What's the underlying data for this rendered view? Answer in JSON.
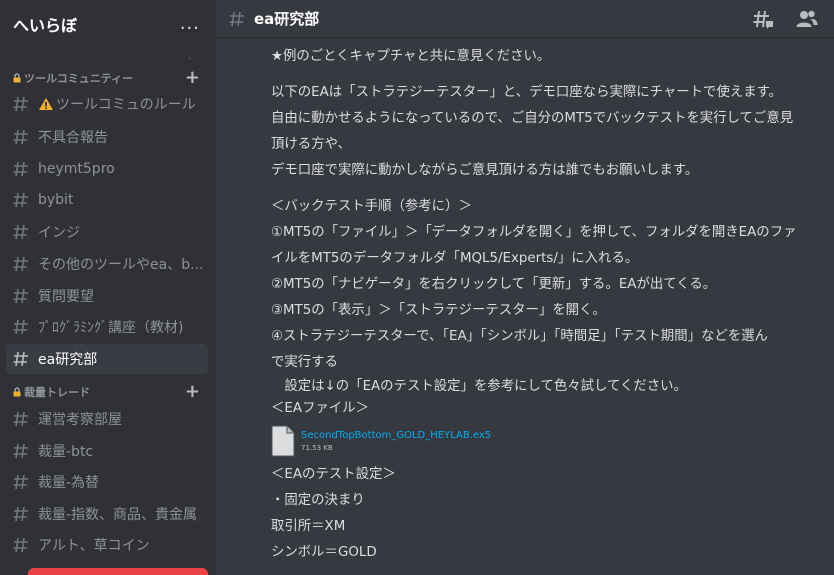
{
  "server": {
    "name": "へいらぼ",
    "menu_label": "..."
  },
  "sidebar": {
    "categories": [
      {
        "label": "ツールコミュニティー",
        "channels": [
          "ツールコミュのルール",
          "不具合報告",
          "heymt5pro",
          "bybit",
          "インジ",
          "その他のツールやea、b...",
          "質問要望",
          "ﾌﾟﾛｸﾞﾗﾐﾝｸﾞ講座（教材)",
          "ea研究部"
        ]
      },
      {
        "label": "裁量トレード",
        "channels": [
          "運営考察部屋",
          "裁量-btc",
          "裁量-為替",
          "裁量-指数、商品、貴金属",
          "アルト、草コイン"
        ]
      }
    ],
    "active_channel": "ea研究部"
  },
  "channel_header": {
    "name": "ea研究部",
    "icons": [
      "threads-icon",
      "members-icon"
    ]
  },
  "message": {
    "lines_1": [
      "★例のごとくキャプチャと共に意見ください。"
    ],
    "lines_2": [
      "以下のEAは「ストラテジーテスター」と、デモ口座なら実際にチャートで使えます。",
      "自由に動かせるようになっているので、ご自分のMT5でバックテストを実行してご意見",
      "頂ける方や、",
      "デモ口座で実際に動かしながらご意見頂ける方は誰でもお願いします。"
    ],
    "lines_3": [
      "＜バックテスト手順（参考に）＞",
      "①MT5の「ファイル」＞「データフォルダを開く」を押して、フォルダを開きEAのファ",
      "イルをMT5のデータフォルダ「MQL5/Experts/」に入れる。",
      "②MT5の「ナビゲータ」を右クリックして「更新」する。EAが出てくる。",
      "③MT5の「表示」＞「ストラテジーテスター」を開く。",
      "④ストラテジーテスターで、「EA」「シンボル」「時間足」「テスト期間」などを選ん",
      "で実行する",
      "　設定は↓の「EAのテスト設定」を参考にして色々試してください。",
      "＜EAファイル＞"
    ],
    "attachment": {
      "name": "SecondTopBottom_GOLD_HEYLAB.ex5",
      "size": "71.53 KB"
    },
    "lines_4": [
      "＜EAのテスト設定＞",
      "・固定の決まり",
      "取引所＝XM",
      "シンボル＝GOLD"
    ]
  },
  "colors": {
    "sidebar_bg": "#2f3136",
    "main_bg": "#36393f",
    "link": "#00aff4",
    "active_bg": "#393c43"
  }
}
